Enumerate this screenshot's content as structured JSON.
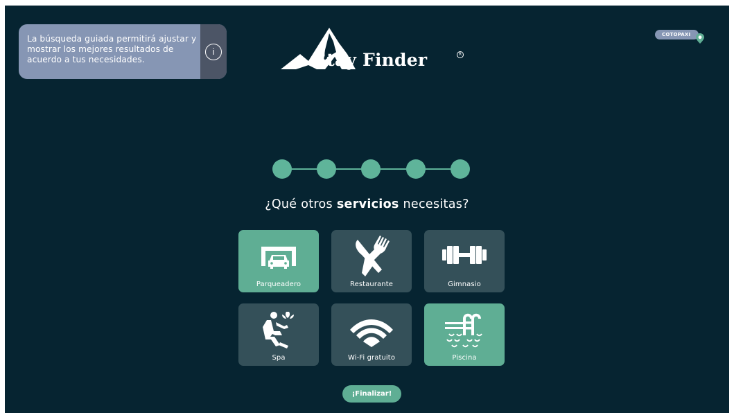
{
  "info": {
    "text": "La búsqueda guiada permitirá ajustar y mostrar los mejores resultados de acuerdo a tus necesidades.",
    "icon": "info-icon",
    "icon_glyph": "i"
  },
  "brand": {
    "name": "Stay Finder",
    "registered": "R"
  },
  "location": {
    "label": "COTOPAXI",
    "icon": "map-pin-icon"
  },
  "stepper": {
    "total": 5,
    "completed": 5
  },
  "question": {
    "prefix": "¿Qué otros ",
    "bold": "servicios",
    "suffix": " necesitas?"
  },
  "services": [
    {
      "label": "Parqueadero",
      "icon": "parking-garage-icon",
      "selected": true
    },
    {
      "label": "Restaurante",
      "icon": "fork-knife-icon",
      "selected": false
    },
    {
      "label": "Gimnasio",
      "icon": "dumbbell-icon",
      "selected": false
    },
    {
      "label": "Spa",
      "icon": "spa-massage-icon",
      "selected": false
    },
    {
      "label": "Wi-Fi gratuito",
      "icon": "wifi-icon",
      "selected": false
    },
    {
      "label": "Piscina",
      "icon": "pool-ladder-icon",
      "selected": true
    }
  ],
  "finish_label": "¡Finalizar!",
  "colors": {
    "background": "#062431",
    "accent": "#5fae94",
    "tile": "#345059",
    "info": "#8696b4"
  }
}
